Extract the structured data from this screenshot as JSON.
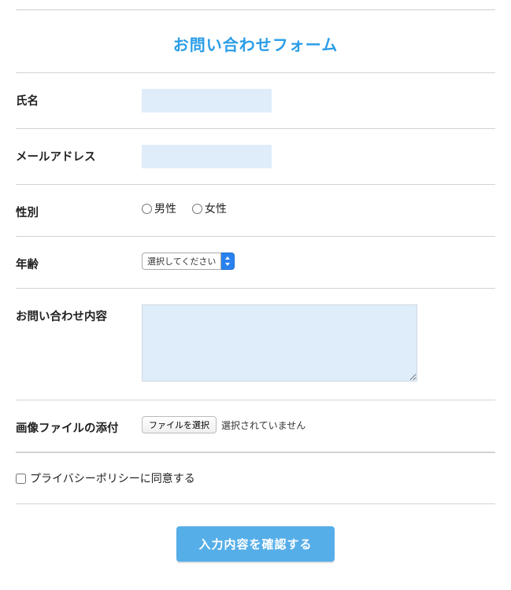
{
  "title": "お問い合わせフォーム",
  "fields": {
    "name": {
      "label": "氏名",
      "value": ""
    },
    "email": {
      "label": "メールアドレス",
      "value": ""
    },
    "gender": {
      "label": "性別",
      "options": {
        "male": "男性",
        "female": "女性"
      }
    },
    "age": {
      "label": "年齢",
      "selected": "選択してください"
    },
    "inquiry": {
      "label": "お問い合わせ内容",
      "value": ""
    },
    "file": {
      "label": "画像ファイルの添付",
      "button": "ファイルを選択",
      "status": "選択されていません"
    }
  },
  "privacy": {
    "label": "プライバシーポリシーに同意する"
  },
  "submit": {
    "label": "入力内容を確認する"
  }
}
